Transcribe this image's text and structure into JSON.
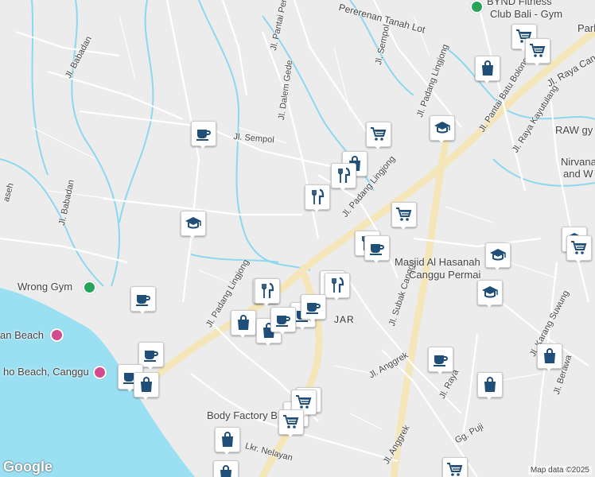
{
  "roads": [
    {
      "label": "Jl. Babadan"
    },
    {
      "label": "Jl. Babadan"
    },
    {
      "label": "Jl. Pantai Pere"
    },
    {
      "label": "Jl. Dalem Gede"
    },
    {
      "label": "Jl. Sempol"
    },
    {
      "label": "Jl. Sempol"
    },
    {
      "label": "Jl. Padang Lingjong"
    },
    {
      "label": "Jl. Padang Lingjong"
    },
    {
      "label": "Jl. Padang Lingjong"
    },
    {
      "label": "Jl. Pantai Batu Bolong"
    },
    {
      "label": "Jl. Raya Kayutulang"
    },
    {
      "label": "Jl. Raya Cangg"
    },
    {
      "label": "Pererenan Tanah Lot"
    },
    {
      "label": "Jl. Subak Canggu"
    },
    {
      "label": "Jl. Anggrek"
    },
    {
      "label": "Jl. Anggrek"
    },
    {
      "label": "Jl. Raya"
    },
    {
      "label": "Gg. Puji"
    },
    {
      "label": "Jl. Karang Suwung"
    },
    {
      "label": "Jl. Berawa"
    },
    {
      "label": "Lkr. Nelayan"
    },
    {
      "label": "aseh"
    }
  ],
  "places": [
    {
      "label": "BYND Fitness",
      "icon": "fitness"
    },
    {
      "label": "Club Bali - Gym",
      "icon": ""
    },
    {
      "label": "Park",
      "icon": ""
    },
    {
      "label": "RAW gy",
      "icon": ""
    },
    {
      "label": "Nirvana",
      "icon": ""
    },
    {
      "label": "and W",
      "icon": ""
    },
    {
      "label": "Wrong Gym",
      "icon": "fitness"
    },
    {
      "label": "an Beach",
      "icon": "attraction"
    },
    {
      "label": "ho Beach, Canggu",
      "icon": "attraction"
    },
    {
      "label": "Masjid Al Hasanah",
      "icon": ""
    },
    {
      "label": "Canggu Permai",
      "icon": ""
    },
    {
      "label": "Body Factory B",
      "icon": ""
    },
    {
      "label": "JAR",
      "icon": ""
    }
  ],
  "markers": [
    {
      "icon": "grocery-cart-icon"
    },
    {
      "icon": "grocery-cart-icon"
    },
    {
      "icon": "shopping-bag-icon"
    },
    {
      "icon": "grocery-cart-icon"
    },
    {
      "icon": "education-icon"
    },
    {
      "icon": "coffee-cup-icon"
    },
    {
      "icon": "shopping-bag-icon"
    },
    {
      "icon": "restaurant-icon"
    },
    {
      "icon": "restaurant-icon"
    },
    {
      "icon": "grocery-cart-icon"
    },
    {
      "icon": "education-icon"
    },
    {
      "icon": "restaurant-icon"
    },
    {
      "icon": "coffee-cup-icon"
    },
    {
      "icon": "education-icon"
    },
    {
      "icon": "education-icon"
    },
    {
      "icon": "grocery-cart-icon"
    },
    {
      "icon": "grocery-cart-icon"
    },
    {
      "icon": "restaurant-icon"
    },
    {
      "icon": "coffee-cup-icon"
    },
    {
      "icon": "restaurant-icon"
    },
    {
      "icon": "restaurant-icon"
    },
    {
      "icon": "shopping-bag-icon"
    },
    {
      "icon": "shopping-bag-icon"
    },
    {
      "icon": "education-icon"
    },
    {
      "icon": "coffee-cup-icon"
    },
    {
      "icon": "coffee-cup-icon"
    },
    {
      "icon": "coffee-cup-icon"
    },
    {
      "icon": "shopping-bag-icon"
    },
    {
      "icon": "coffee-cup-icon"
    },
    {
      "icon": "shopping-bag-icon"
    },
    {
      "icon": "shopping-bag-icon"
    },
    {
      "icon": "education-icon"
    },
    {
      "icon": "grocery-cart-icon"
    },
    {
      "icon": "grocery-cart-icon"
    },
    {
      "icon": "grocery-cart-icon"
    },
    {
      "icon": "shopping-bag-icon"
    },
    {
      "icon": "shopping-bag-icon"
    },
    {
      "icon": "grocery-cart-icon"
    },
    {
      "icon": "coffee-cup-icon"
    },
    {
      "icon": "coffee-cup-icon"
    }
  ],
  "attribution": {
    "logo": "Google",
    "map_data": "Map data ©2025"
  },
  "colors": {
    "land": "#ececec",
    "water": "#9adff2",
    "river": "#8cd8ee",
    "road": "#ffffff",
    "main_road": "#f4e6b8",
    "marker_icon": "#1f4e79",
    "fitness_dot": "#27a35a",
    "attraction_dot": "#d24b8f"
  }
}
